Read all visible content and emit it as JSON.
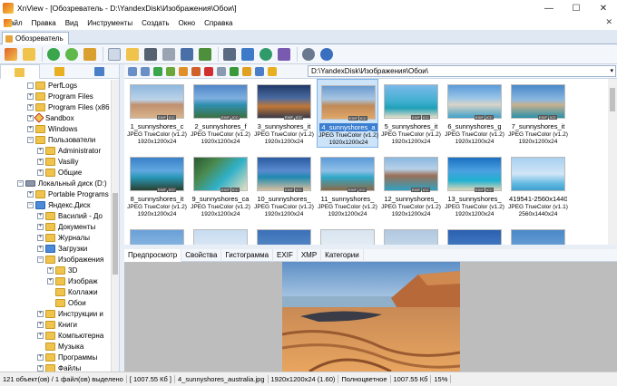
{
  "window": {
    "title": "XnView - [Обозреватель - D:\\YandexDisk\\Изображения\\Обои\\]",
    "minimize": "—",
    "maximize": "☐",
    "close": "✕"
  },
  "menu": {
    "items": [
      "Файл",
      "Правка",
      "Вид",
      "Инструменты",
      "Создать",
      "Окно",
      "Справка"
    ],
    "close": "✕"
  },
  "tab": {
    "label": "Обозреватель"
  },
  "address": {
    "path": "D:\\YandexDisk\\Изображения\\Обои\\",
    "dropdown": "▾"
  },
  "tree": {
    "items": [
      {
        "label": "PerfLogs"
      },
      {
        "label": "Program Files"
      },
      {
        "label": "Program Files (x86"
      },
      {
        "label": "Sandbox"
      },
      {
        "label": "Windows"
      },
      {
        "label": "Пользователи"
      },
      {
        "label": "Administrator"
      },
      {
        "label": "Vasiliy"
      },
      {
        "label": "Общие"
      },
      {
        "label": "Локальный диск (D:)"
      },
      {
        "label": "Portable Programs"
      },
      {
        "label": "Яндекс.Диск"
      },
      {
        "label": "Василий - До"
      },
      {
        "label": "Документы"
      },
      {
        "label": "Журналы"
      },
      {
        "label": "Загрузки"
      },
      {
        "label": "Изображения"
      },
      {
        "label": "3D"
      },
      {
        "label": "Изображ"
      },
      {
        "label": "Коллажи"
      },
      {
        "label": "Обои"
      },
      {
        "label": "Инструкции и"
      },
      {
        "label": "Книги"
      },
      {
        "label": "Компьютерна"
      },
      {
        "label": "Музыка"
      },
      {
        "label": "Программы"
      },
      {
        "label": "Файлы"
      }
    ]
  },
  "thumbnails": {
    "items": [
      {
        "name": "1_sunnyshores_c",
        "info": "JPEG TrueColor (v1.2)",
        "dims": "1920x1200x24"
      },
      {
        "name": "2_sunnyshores_f",
        "info": "JPEG TrueColor (v1.2)",
        "dims": "1920x1200x24"
      },
      {
        "name": "3_sunnyshores_it",
        "info": "JPEG TrueColor (v1.2)",
        "dims": "1920x1200x24"
      },
      {
        "name": "4_sunnyshores_a",
        "info": "JPEG TrueColor (v1.2)",
        "dims": "1920x1200x24"
      },
      {
        "name": "5_sunnyshores_it",
        "info": "JPEG TrueColor (v1.2)",
        "dims": "1920x1200x24"
      },
      {
        "name": "6_sunnyshores_g",
        "info": "JPEG TrueColor (v1.2)",
        "dims": "1920x1200x24"
      },
      {
        "name": "7_sunnyshores_it",
        "info": "JPEG TrueColor (v1.2)",
        "dims": "1920x1200x24"
      },
      {
        "name": "8_sunnyshores_it",
        "info": "JPEG TrueColor (v1.2)",
        "dims": "1920x1200x24"
      },
      {
        "name": "9_sunnyshores_ca",
        "info": "JPEG TrueColor (v1.2)",
        "dims": "1920x1200x24"
      },
      {
        "name": "10_sunnyshores_",
        "info": "JPEG TrueColor (v1.2)",
        "dims": "1920x1200x24"
      },
      {
        "name": "11_sunnyshores_",
        "info": "JPEG TrueColor (v1.2)",
        "dims": "1920x1200x24"
      },
      {
        "name": "12_sunnyshores_",
        "info": "JPEG TrueColor (v1.2)",
        "dims": "1920x1200x24"
      },
      {
        "name": "13_sunnyshores_",
        "info": "JPEG TrueColor (v1.2)",
        "dims": "1920x1200x24"
      },
      {
        "name": "419541-2560x1440",
        "info": "JPEG TrueColor (v1.1)",
        "dims": "2560x1440x24"
      }
    ],
    "tags": [
      "EXIF",
      "ICC"
    ]
  },
  "preview_tabs": [
    "Предпросмотр",
    "Свойства",
    "Гистограмма",
    "EXIF",
    "XMP",
    "Категории"
  ],
  "status": {
    "count": "121 объект(ов) / 1 файл(ов) выделено",
    "size": "[ 1007.55 Кб ]",
    "filename": "4_sunnyshores_australia.jpg",
    "dims": "1920x1200x24 (1.60)",
    "color": "Полноцветное",
    "filesize": "1007.55 Кб",
    "zoom": "15%"
  }
}
